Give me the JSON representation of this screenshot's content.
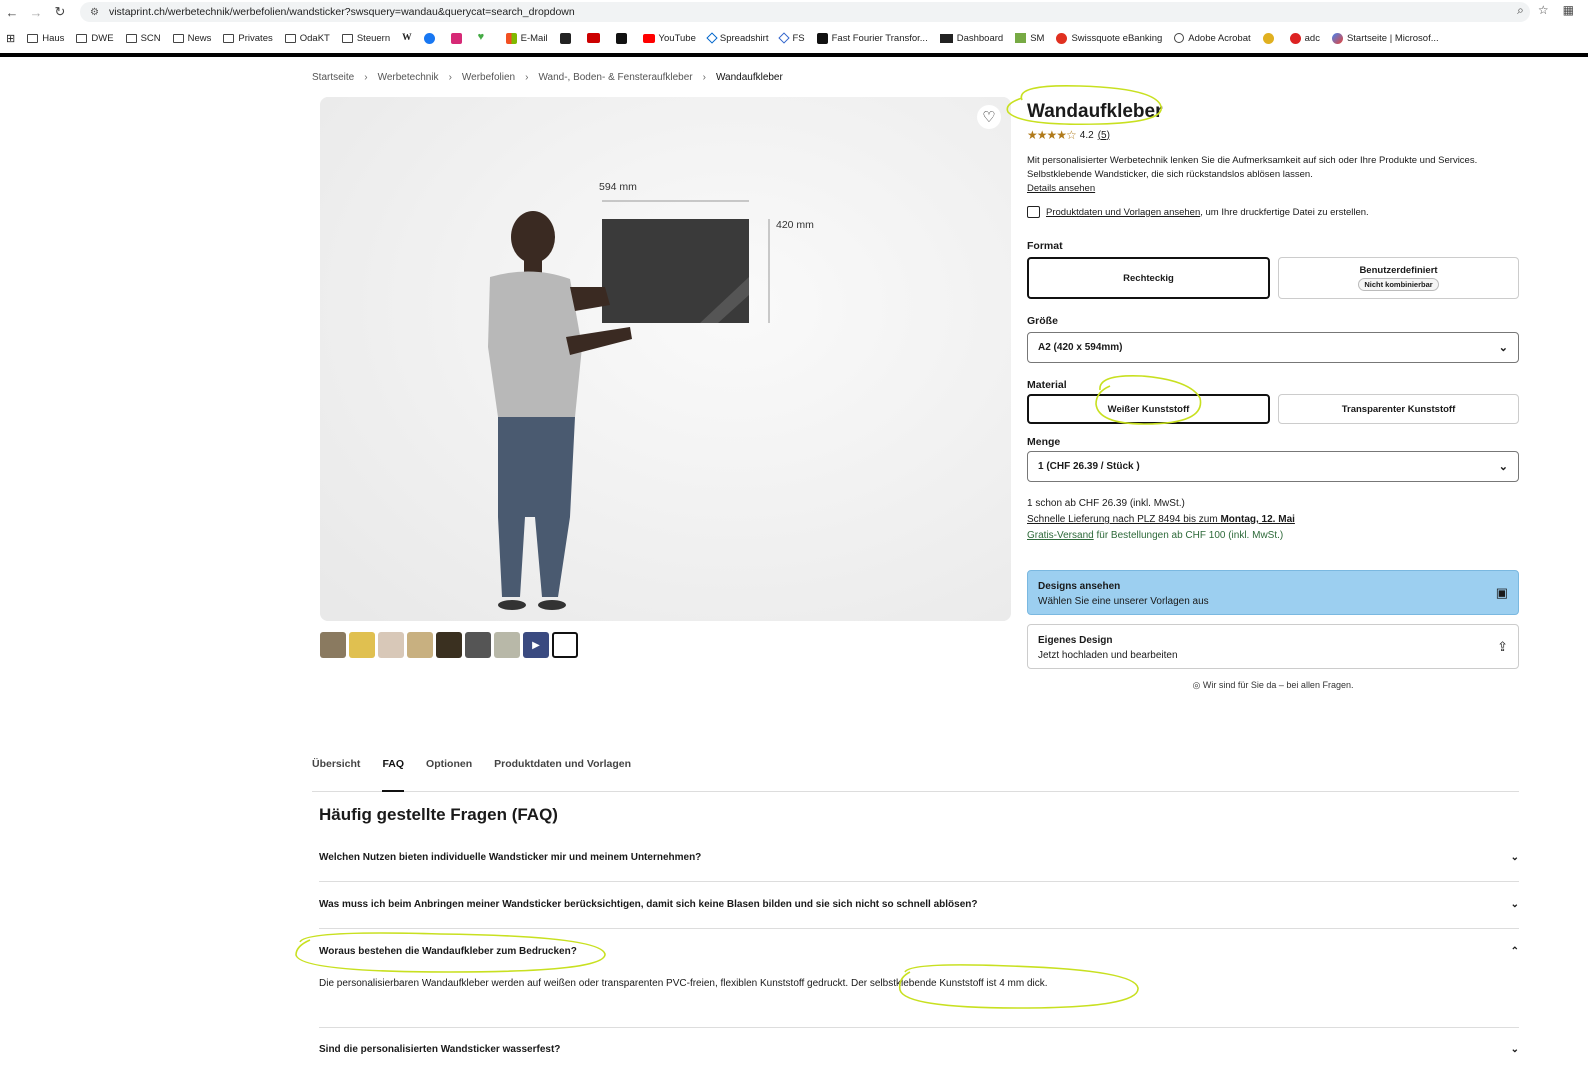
{
  "browser": {
    "url": "vistaprint.ch/werbetechnik/werbefolien/wandsticker?swsquery=wandau&querycat=search_dropdown",
    "bookmarks": [
      "Haus",
      "DWE",
      "SCN",
      "News",
      "Privates",
      "OdaKT",
      "Steuern",
      "W",
      "",
      "",
      "",
      "E-Mail",
      "W",
      "SRF",
      "NZZ",
      "YouTube",
      "Spreadshirt",
      "FS",
      "Fast Fourier Transfor...",
      "Dashboard",
      "SM",
      "Swissquote eBanking",
      "Adobe Acrobat",
      "",
      "adc",
      "Startseite | Microsof..."
    ]
  },
  "breadcrumb": [
    "Startseite",
    "Werbetechnik",
    "Werbefolien",
    "Wand-, Boden- & Fensteraufkleber",
    "Wandaufkleber"
  ],
  "gallery": {
    "dim_width": "594 mm",
    "dim_height": "420 mm",
    "thumb_count": 9
  },
  "product": {
    "title": "Wandaufkleber",
    "rating": "4.2",
    "rating_count": "(5)",
    "stars": "★★★★☆",
    "description": "Mit personalisierter Werbetechnik lenken Sie die Aufmerksamkeit auf sich oder Ihre Produkte und Services. Selbstklebende Wandsticker, die sich rückstandslos ablösen lassen.",
    "details_link": "Details ansehen",
    "templates_link": "Produktdaten und Vorlagen ansehen",
    "templates_suffix": ", um Ihre druckfertige Datei zu erstellen."
  },
  "format": {
    "label": "Format",
    "option1": "Rechteckig",
    "option2": "Benutzerdefiniert",
    "option2_badge": "Nicht kombinierbar"
  },
  "size": {
    "label": "Größe",
    "value": "A2 (420 x 594mm)"
  },
  "material": {
    "label": "Material",
    "option1": "Weißer Kunststoff",
    "option2": "Transparenter Kunststoff"
  },
  "quantity": {
    "label": "Menge",
    "value": "1 (CHF 26.39 / Stück )"
  },
  "pricing": {
    "from": "1 schon ab CHF 26.39 (inkl. MwSt.)",
    "delivery": "Schnelle Lieferung nach PLZ 8494 bis zum ",
    "delivery_date": "Montag, 12. Mai",
    "shipping_link": "Gratis-Versand",
    "shipping_text": " für Bestellungen ab CHF 100 (inkl. MwSt.)"
  },
  "cta": {
    "designs_title": "Designs ansehen",
    "designs_sub": "Wählen Sie eine unserer Vorlagen aus",
    "own_title": "Eigenes Design",
    "own_sub": "Jetzt hochladen und bearbeiten",
    "help": "Wir sind für Sie da – bei allen Fragen."
  },
  "tabs": [
    "Übersicht",
    "FAQ",
    "Optionen",
    "Produktdaten und Vorlagen"
  ],
  "faq": {
    "title": "Häufig gestellte Fragen (FAQ)",
    "q1": "Welchen Nutzen bieten individuelle Wandsticker mir und meinem Unternehmen?",
    "q2": "Was muss ich beim Anbringen meiner Wandsticker berücksichtigen, damit sich keine Blasen bilden und sie sich nicht so schnell ablösen?",
    "q3": "Woraus bestehen die Wandaufkleber zum Bedrucken?",
    "a3_part1": "Die personalisierbaren Wandaufkleber werden auf weißen oder transparenten PVC-freien, flexiblen Kunststoff gedruckt.",
    "a3_part2": " Der selbstklebende Kunststoff ist 4 mm dick.",
    "q4": "Sind die personalisierten Wandsticker wasserfest?"
  },
  "colors": {
    "accent_blue": "#9ccff0",
    "highlight": "#c8e020",
    "shipping_green": "#2e6a3a"
  }
}
